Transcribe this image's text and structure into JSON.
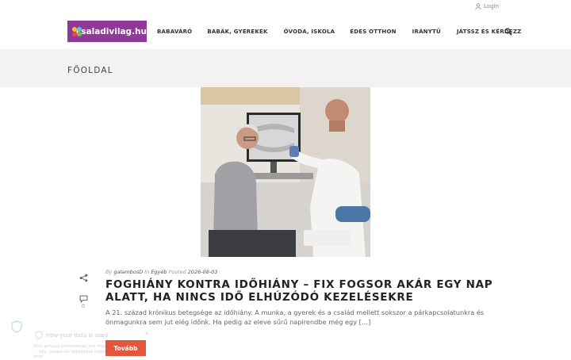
{
  "topbar": {
    "login_label": "Login"
  },
  "header": {
    "logo_text": "csaladivilag.hu",
    "nav": [
      "BABAVÁRÓ",
      "BABÁK, GYEREKEK",
      "ÓVODA, ISKOLA",
      "ÉDES OTTHON",
      "IRÁNYTŰ",
      "JÁTSSZ ÉS KÉRDEZZ"
    ]
  },
  "banner": {
    "title": "FŐOLDAL"
  },
  "post": {
    "meta_by": "By",
    "author": "galambosD",
    "meta_in": "In",
    "category": "Egyéb",
    "meta_posted": "Posted",
    "date": "2026-08-03",
    "title": "FOGHIÁNY KONTRA IDŐHIÁNY – FIX FOGSOR AKÁR EGY NAP ALATT, HA NINCS IDŐ ELHÚZÓDÓ KEZELÉSEKRE",
    "excerpt": "A 21. század krónikus betegsége az időhiány. A munka, a gyerek és a család mellett sokszor a párkapcsolatunkra és önmagunkra sem jut elég időnk. Ha pedig az eleve sűrű napirendbe még egy […]",
    "comment_count": "0"
  },
  "cookie": {
    "title": "How your data is used",
    "body": "Your privacy preferences are important ... elly, based on legitimate interest or your",
    "close": "×",
    "continue_label": "Tovább"
  },
  "colors": {
    "logo_bg": "#8e3a97",
    "button_bg": "#e4553b",
    "banner_bg": "#f2f2f2"
  }
}
